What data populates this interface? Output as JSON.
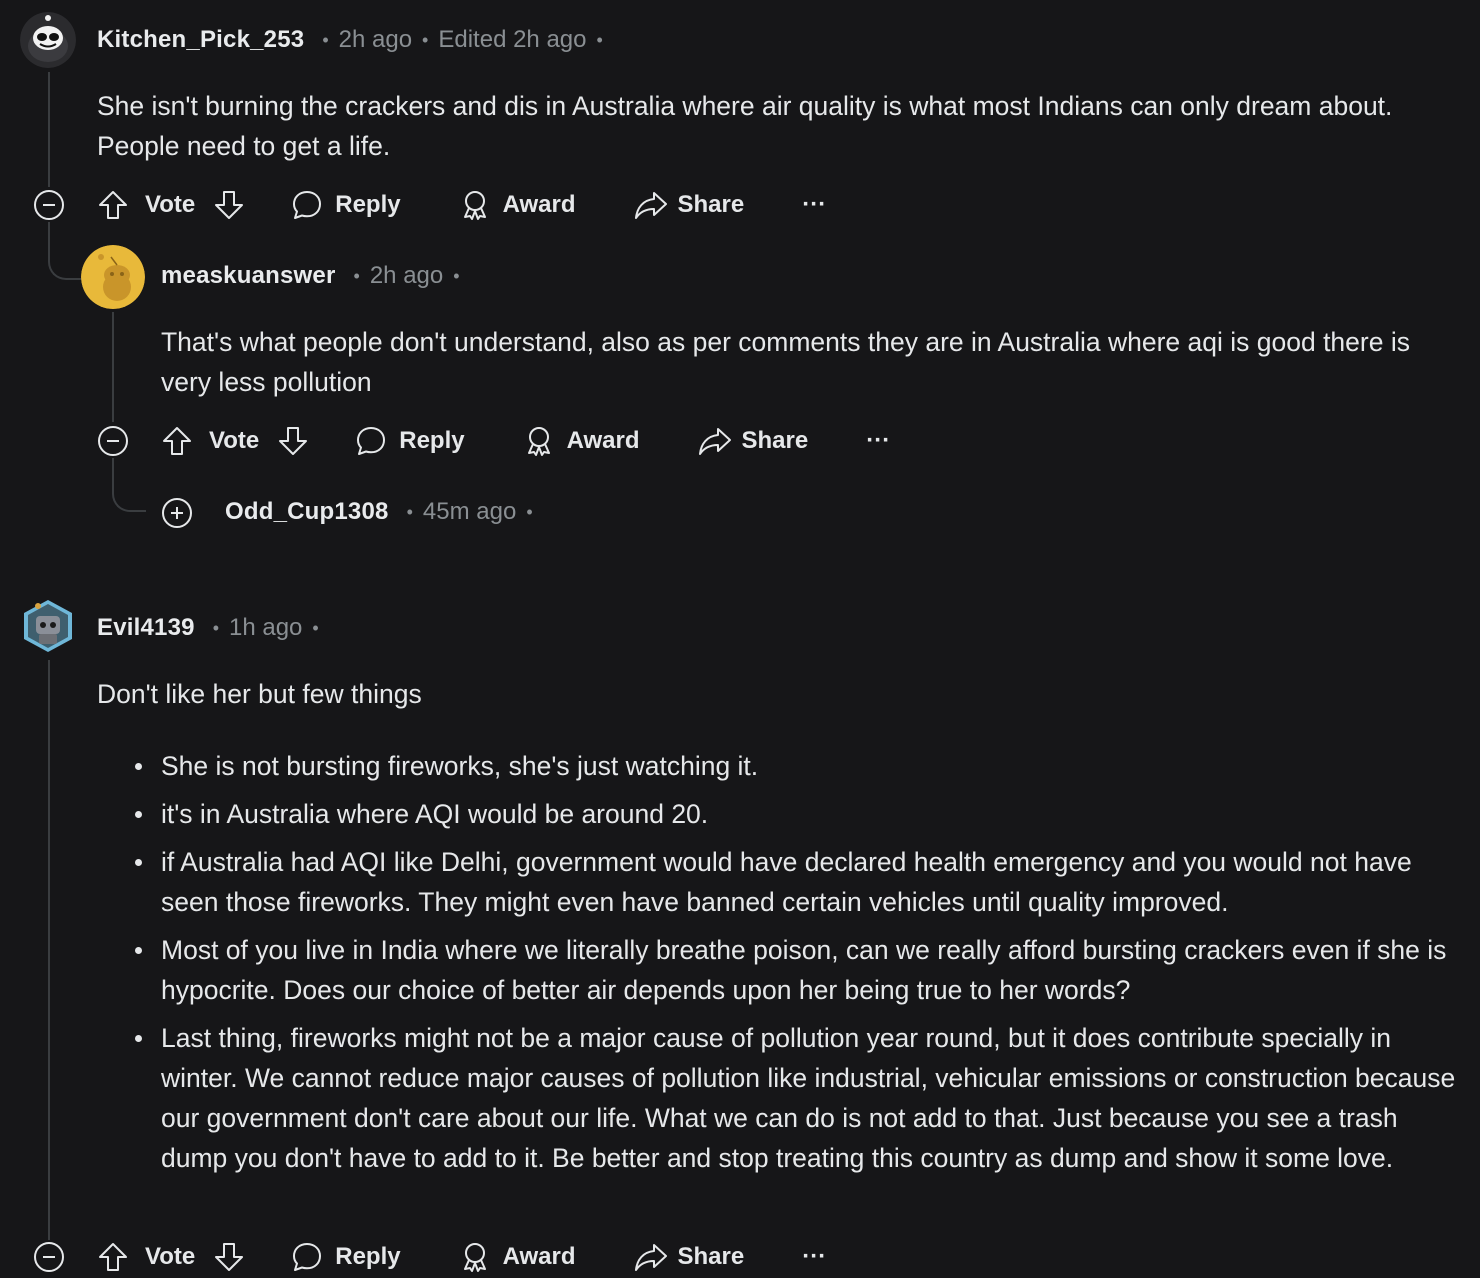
{
  "comments": [
    {
      "username": "Kitchen_Pick_253",
      "time": "2h ago",
      "edited": "Edited 2h ago",
      "body": "She isn't burning the crackers and dis in Australia where air quality is what most Indians can only dream about. People need to get a life."
    },
    {
      "username": "measkuanswer",
      "time": "2h ago",
      "body": "That's what people don't understand, also as per comments they are in Australia where aqi is good there is very less pollution"
    },
    {
      "username": "Odd_Cup1308",
      "time": "45m ago"
    },
    {
      "username": "Evil4139",
      "time": "1h ago",
      "intro": "Don't like her but few things",
      "bullets": [
        "She is not bursting fireworks, she's just watching it.",
        "it's in Australia where AQI would be around 20.",
        "if Australia had AQI like Delhi, government would have declared health emergency and you would not have seen those fireworks. They might even have banned certain vehicles until quality improved.",
        "Most of you live in India where we literally breathe poison, can we really afford bursting crackers even if she is hypocrite. Does our choice of better air depends upon her being true to her words?",
        "Last thing, fireworks might not be a major cause of pollution year round, but it does contribute specially in winter. We cannot reduce major causes of pollution like industrial, vehicular emissions or construction because our government don't care about our life. What we can do is not add to that. Just because you see a trash dump you don't have to add to it. Be better and stop treating this country as dump and show it some love."
      ]
    }
  ],
  "actions": {
    "vote": "Vote",
    "reply": "Reply",
    "award": "Award",
    "share": "Share",
    "more": "···"
  },
  "icons": {
    "collapse": "minus-circle-icon",
    "expand": "plus-circle-icon",
    "upvote": "arrow-up-icon",
    "downvote": "arrow-down-icon",
    "reply": "speech-bubble-icon",
    "award": "award-ribbon-icon",
    "share": "share-arrow-icon"
  },
  "colors": {
    "background": "#161618",
    "text": "#e6e8ea",
    "muted": "#8a8f93",
    "thread_line": "#3a3d40"
  }
}
